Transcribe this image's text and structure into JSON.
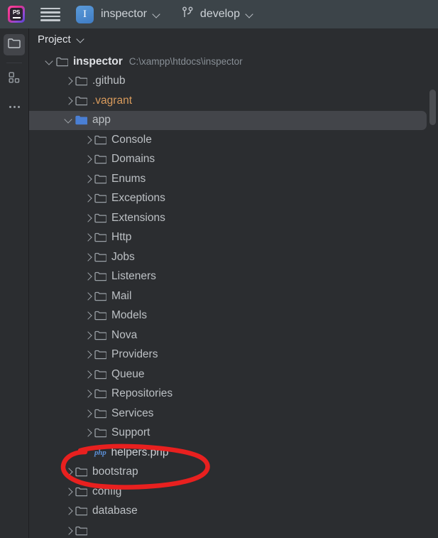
{
  "titlebar": {
    "app_logo_icon": "phpstorm-logo-icon",
    "app_logo_text": "PS",
    "menu_icon": "hamburger-menu-icon",
    "project_badge_letter": "I",
    "project_name": "inspector",
    "project_chevron_icon": "chevron-down-icon",
    "vcs_branch_icon": "git-branch-icon",
    "branch_name": "develop",
    "branch_chevron_icon": "chevron-down-icon",
    "background_color": "#3c4449"
  },
  "activitybar": {
    "items": [
      {
        "name": "project-tool-window",
        "icon": "folder-icon",
        "active": true
      },
      {
        "name": "structure-tool-window",
        "icon": "structure-blocks-icon",
        "active": false
      },
      {
        "name": "more-tool-windows",
        "icon": "ellipsis-icon",
        "active": false
      }
    ]
  },
  "panel": {
    "title": "Project",
    "title_chevron_icon": "chevron-down-icon",
    "selection_color": "#43454a",
    "excluded_color": "#d99b5c",
    "scrollbar": {
      "name": "vertical-scrollbar",
      "visible": true
    }
  },
  "tree": [
    {
      "label": "inspector",
      "path": "C:\\xampp\\htdocs\\inspector",
      "indent": 0,
      "twisty": "down",
      "icon": "folder-icon",
      "kind": "root",
      "selected": false
    },
    {
      "label": ".github",
      "indent": 1,
      "twisty": "right",
      "icon": "folder-icon",
      "kind": "folder",
      "selected": false
    },
    {
      "label": ".vagrant",
      "indent": 1,
      "twisty": "right",
      "icon": "folder-icon",
      "kind": "folder-excluded",
      "selected": false
    },
    {
      "label": "app",
      "indent": 1,
      "twisty": "down",
      "icon": "folder-icon-blue",
      "kind": "folder-source",
      "selected": true
    },
    {
      "label": "Console",
      "indent": 2,
      "twisty": "right",
      "icon": "folder-icon",
      "kind": "folder",
      "selected": false
    },
    {
      "label": "Domains",
      "indent": 2,
      "twisty": "right",
      "icon": "folder-icon",
      "kind": "folder",
      "selected": false
    },
    {
      "label": "Enums",
      "indent": 2,
      "twisty": "right",
      "icon": "folder-icon",
      "kind": "folder",
      "selected": false
    },
    {
      "label": "Exceptions",
      "indent": 2,
      "twisty": "right",
      "icon": "folder-icon",
      "kind": "folder",
      "selected": false
    },
    {
      "label": "Extensions",
      "indent": 2,
      "twisty": "right",
      "icon": "folder-icon",
      "kind": "folder",
      "selected": false
    },
    {
      "label": "Http",
      "indent": 2,
      "twisty": "right",
      "icon": "folder-icon",
      "kind": "folder",
      "selected": false
    },
    {
      "label": "Jobs",
      "indent": 2,
      "twisty": "right",
      "icon": "folder-icon",
      "kind": "folder",
      "selected": false
    },
    {
      "label": "Listeners",
      "indent": 2,
      "twisty": "right",
      "icon": "folder-icon",
      "kind": "folder",
      "selected": false
    },
    {
      "label": "Mail",
      "indent": 2,
      "twisty": "right",
      "icon": "folder-icon",
      "kind": "folder",
      "selected": false
    },
    {
      "label": "Models",
      "indent": 2,
      "twisty": "right",
      "icon": "folder-icon",
      "kind": "folder",
      "selected": false
    },
    {
      "label": "Nova",
      "indent": 2,
      "twisty": "right",
      "icon": "folder-icon",
      "kind": "folder",
      "selected": false
    },
    {
      "label": "Providers",
      "indent": 2,
      "twisty": "right",
      "icon": "folder-icon",
      "kind": "folder",
      "selected": false
    },
    {
      "label": "Queue",
      "indent": 2,
      "twisty": "right",
      "icon": "folder-icon",
      "kind": "folder",
      "selected": false
    },
    {
      "label": "Repositories",
      "indent": 2,
      "twisty": "right",
      "icon": "folder-icon",
      "kind": "folder",
      "selected": false
    },
    {
      "label": "Services",
      "indent": 2,
      "twisty": "right",
      "icon": "folder-icon",
      "kind": "folder",
      "selected": false
    },
    {
      "label": "Support",
      "indent": 2,
      "twisty": "right",
      "icon": "folder-icon",
      "kind": "folder",
      "selected": false
    },
    {
      "label": "helpers.php",
      "indent": 2,
      "twisty": "none",
      "icon": "php-file-icon",
      "icon_text": "php",
      "kind": "file",
      "selected": false
    },
    {
      "label": "bootstrap",
      "indent": 1,
      "twisty": "right",
      "icon": "folder-icon",
      "kind": "folder",
      "selected": false
    },
    {
      "label": "config",
      "indent": 1,
      "twisty": "right",
      "icon": "folder-icon",
      "kind": "folder",
      "selected": false
    },
    {
      "label": "database",
      "indent": 1,
      "twisty": "right",
      "icon": "folder-icon",
      "kind": "folder",
      "selected": false
    },
    {
      "label": "",
      "indent": 1,
      "twisty": "right",
      "icon": "folder-icon",
      "kind": "folder",
      "selected": false
    }
  ],
  "annotation": {
    "name": "red-ellipse-highlight",
    "target_label": "helpers.php",
    "color": "#e8201f",
    "shape": "hand-drawn-ellipse"
  }
}
